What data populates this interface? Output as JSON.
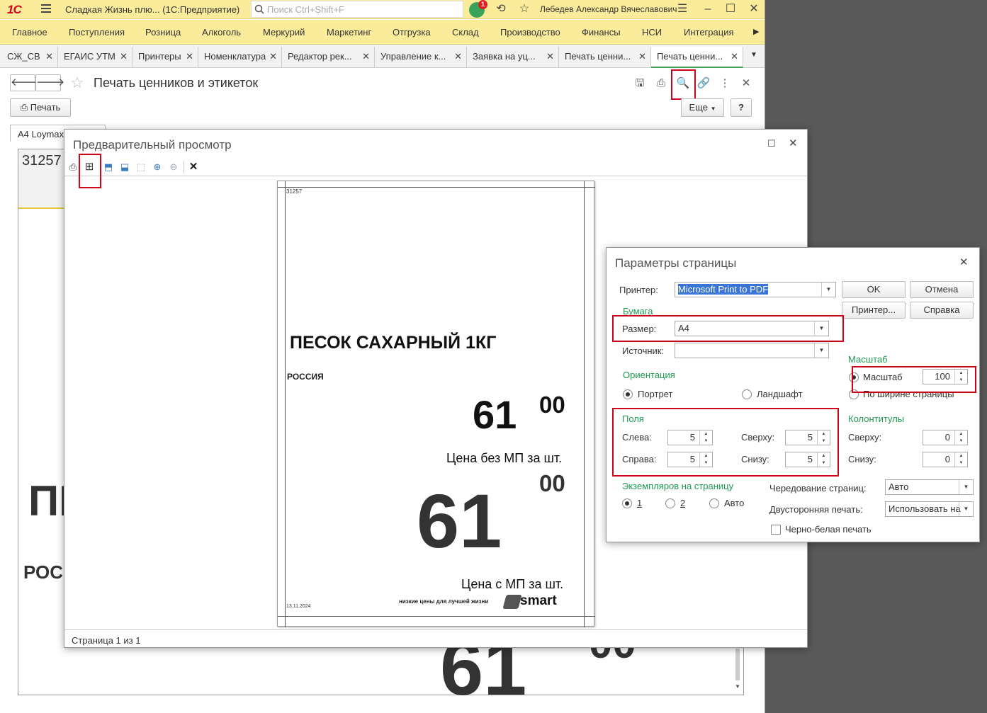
{
  "app": {
    "logo": "1С",
    "title": "Сладкая Жизнь плю...  (1С:Предприятие)",
    "search_placeholder": "Поиск Ctrl+Shift+F",
    "notifications_count": "1",
    "user": "Лебедев Александр Вячеславович"
  },
  "menu": [
    "Главное",
    "Поступления",
    "Розница",
    "Алкоголь",
    "Меркурий",
    "Маркетинг",
    "Отгрузка",
    "Склад",
    "Производство",
    "Финансы",
    "НСИ",
    "Интеграция"
  ],
  "tabs": [
    "СЖ_СВ",
    "ЕГАИС УТМ",
    "Принтеры",
    "Номенклатура",
    "Редактор рек...",
    "Управление к...",
    "Заявка на уц...",
    "Печать ценни...",
    "Печать ценни..."
  ],
  "form": {
    "title": "Печать ценников и этикеток",
    "print_button": "Печать",
    "more_button": "Еще",
    "help_button": "?",
    "doc_tab": "A4 Loymax",
    "doc_code": "31257",
    "doc_big_text": "ПЕ",
    "doc_country": "РОС",
    "doc_price": "61",
    "doc_kop": "00"
  },
  "preview": {
    "title": "Предварительный просмотр",
    "status": "Страница 1 из 1",
    "page": {
      "code": "31257",
      "product": "ПЕСОК САХАРНЫЙ 1КГ",
      "country": "РОССИЯ",
      "price1_rub": "61",
      "price1_kop": "00",
      "price1_label": "Цена без МП за шт.",
      "price2_rub": "61",
      "price2_kop": "00",
      "price2_label": "Цена с МП за шт.",
      "date": "13.11.2024",
      "slogan": "низкие цены для лучшей жизни",
      "brand": "smart"
    }
  },
  "dialog": {
    "title": "Параметры страницы",
    "printer_label": "Принтер:",
    "printer_value": "Microsoft Print to PDF",
    "ok": "OK",
    "cancel": "Отмена",
    "printer_btn": "Принтер...",
    "help_btn": "Справка",
    "paper_group": "Бумага",
    "size_label": "Размер:",
    "size_value": "A4",
    "source_label": "Источник:",
    "source_value": "",
    "scale_group": "Масштаб",
    "scale_radio": "Масштаб",
    "scale_value": "100",
    "fit_width": "По ширине страницы",
    "orientation_group": "Ориентация",
    "portrait": "Портрет",
    "landscape": "Ландшафт",
    "margins_group": "Поля",
    "left_label": "Слева:",
    "left_value": "5",
    "right_label": "Справа:",
    "right_value": "5",
    "top_label": "Сверху:",
    "top_value": "5",
    "bottom_label": "Снизу:",
    "bottom_value": "5",
    "headers_group": "Колонтитулы",
    "h_top_label": "Сверху:",
    "h_top_value": "0",
    "h_bottom_label": "Снизу:",
    "h_bottom_value": "0",
    "copies_group": "Экземпляров на страницу",
    "copies_1": "1",
    "copies_2": "2",
    "copies_auto": "Авто",
    "collate_label": "Чередование страниц:",
    "collate_value": "Авто",
    "duplex_label": "Двусторонняя печать:",
    "duplex_value": "Использовать на",
    "bw_label": "Черно-белая печать"
  }
}
